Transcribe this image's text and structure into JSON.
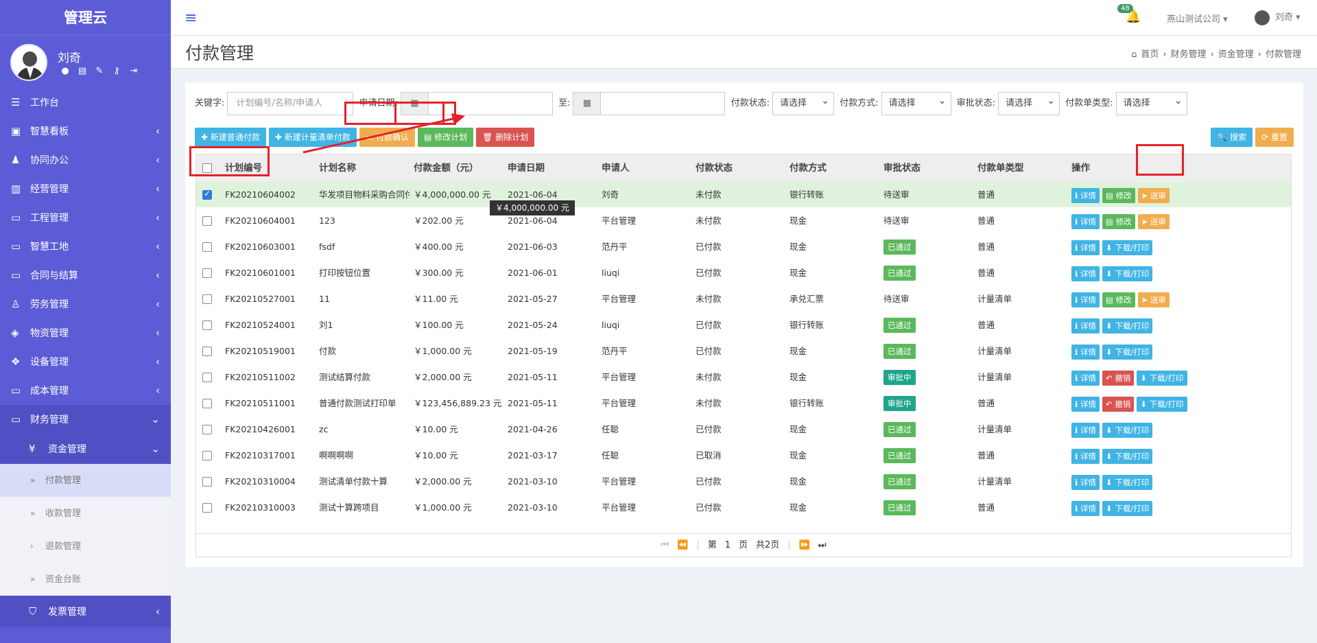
{
  "app": {
    "brand": "管理云"
  },
  "user": {
    "name": "刘奇",
    "icons": [
      "user-icon",
      "card-icon",
      "edit-icon",
      "key-icon",
      "logout-icon"
    ]
  },
  "header": {
    "notification_count": "48",
    "company": "燕山测试公司",
    "user": "刘奇"
  },
  "sidebar": {
    "items": [
      {
        "label": "工作台",
        "icon": "list-icon"
      },
      {
        "label": "智慧看板",
        "icon": "monitor-icon"
      },
      {
        "label": "协同办公",
        "icon": "users-icon"
      },
      {
        "label": "经营管理",
        "icon": "bar-chart-icon"
      },
      {
        "label": "工程管理",
        "icon": "desktop-icon"
      },
      {
        "label": "智慧工地",
        "icon": "desktop-icon"
      },
      {
        "label": "合同与结算",
        "icon": "desktop-icon"
      },
      {
        "label": "劳务管理",
        "icon": "worker-icon"
      },
      {
        "label": "物资管理",
        "icon": "cube-icon"
      },
      {
        "label": "设备管理",
        "icon": "cubes-icon"
      },
      {
        "label": "成本管理",
        "icon": "desktop-icon"
      },
      {
        "label": "财务管理",
        "icon": "desktop-icon"
      }
    ],
    "sub": {
      "label": "资金管理",
      "icon": "yen-icon"
    },
    "sub_items": [
      {
        "label": "付款管理",
        "active": true
      },
      {
        "label": "收款管理",
        "active": false
      },
      {
        "label": "退款管理",
        "active": false
      },
      {
        "label": "资金台账",
        "active": false
      }
    ],
    "last": {
      "label": "发票管理",
      "icon": "tags-icon"
    }
  },
  "page": {
    "title": "付款管理",
    "breadcrumb": [
      "首页",
      "财务管理",
      "资金管理",
      "付款管理"
    ]
  },
  "filters": {
    "keyword_label": "关键字:",
    "keyword_placeholder": "计划编号/名称/申请人",
    "date_label": "申请日期:",
    "to_label": "至:",
    "pay_status_label": "付款状态:",
    "pay_method_label": "付款方式:",
    "approve_status_label": "审批状态:",
    "order_type_label": "付款单类型:",
    "select_default": "请选择"
  },
  "toolbar": {
    "new_normal": "新建普通付款",
    "new_measure": "新建计量清单付款",
    "confirm": "付款确认",
    "modify": "修改计划",
    "delete": "删除计划",
    "search": "搜索",
    "reset": "重置"
  },
  "table": {
    "columns": [
      "计划编号",
      "计划名称",
      "付款金额（元）",
      "申请日期",
      "申请人",
      "付款状态",
      "付款方式",
      "审批状态",
      "付款单类型",
      "操作"
    ],
    "rows": [
      {
        "code": "FK20210604002",
        "name": "华发项目物料采购合同付",
        "amount": "￥4,000,000.00 元",
        "date": "2021-06-04",
        "applicant": "刘奇",
        "pay_status": "未付款",
        "method": "银行转账",
        "approve": "待送审",
        "type": "普通",
        "checked": true,
        "actions": [
          "详情",
          "修改",
          "送审"
        ]
      },
      {
        "code": "FK20210604001",
        "name": "123",
        "amount": "￥202.00 元",
        "date": "2021-06-04",
        "applicant": "平台管理",
        "pay_status": "未付款",
        "method": "现金",
        "approve": "待送审",
        "type": "普通",
        "checked": false,
        "actions": [
          "详情",
          "修改",
          "送审"
        ]
      },
      {
        "code": "FK20210603001",
        "name": "fsdf",
        "amount": "￥400.00 元",
        "date": "2021-06-03",
        "applicant": "范丹平",
        "pay_status": "已付款",
        "method": "现金",
        "approve": "已通过",
        "type": "普通",
        "checked": false,
        "actions": [
          "详情",
          "下载/打印"
        ]
      },
      {
        "code": "FK20210601001",
        "name": "打印按钮位置",
        "amount": "￥300.00 元",
        "date": "2021-06-01",
        "applicant": "liuqi",
        "pay_status": "已付款",
        "method": "现金",
        "approve": "已通过",
        "type": "普通",
        "checked": false,
        "actions": [
          "详情",
          "下载/打印"
        ]
      },
      {
        "code": "FK20210527001",
        "name": "11",
        "amount": "￥11.00 元",
        "date": "2021-05-27",
        "applicant": "平台管理",
        "pay_status": "未付款",
        "method": "承兑汇票",
        "approve": "待送审",
        "type": "计量清单",
        "checked": false,
        "actions": [
          "详情",
          "修改",
          "送审"
        ]
      },
      {
        "code": "FK20210524001",
        "name": "刘1",
        "amount": "￥100.00 元",
        "date": "2021-05-24",
        "applicant": "liuqi",
        "pay_status": "已付款",
        "method": "银行转账",
        "approve": "已通过",
        "type": "普通",
        "checked": false,
        "actions": [
          "详情",
          "下载/打印"
        ]
      },
      {
        "code": "FK20210519001",
        "name": "付款",
        "amount": "￥1,000.00 元",
        "date": "2021-05-19",
        "applicant": "范丹平",
        "pay_status": "已付款",
        "method": "现金",
        "approve": "已通过",
        "type": "计量清单",
        "checked": false,
        "actions": [
          "详情",
          "下载/打印"
        ]
      },
      {
        "code": "FK20210511002",
        "name": "测试结算付款",
        "amount": "￥2,000.00 元",
        "date": "2021-05-11",
        "applicant": "平台管理",
        "pay_status": "未付款",
        "method": "现金",
        "approve": "审批中",
        "type": "计量清单",
        "checked": false,
        "actions": [
          "详情",
          "撤销",
          "下载/打印"
        ]
      },
      {
        "code": "FK20210511001",
        "name": "普通付款测试打印单",
        "amount": "￥123,456,889.23 元",
        "date": "2021-05-11",
        "applicant": "平台管理",
        "pay_status": "未付款",
        "method": "银行转账",
        "approve": "审批中",
        "type": "普通",
        "checked": false,
        "actions": [
          "详情",
          "撤销",
          "下载/打印"
        ]
      },
      {
        "code": "FK20210426001",
        "name": "zc",
        "amount": "￥10.00 元",
        "date": "2021-04-26",
        "applicant": "任聪",
        "pay_status": "已付款",
        "method": "现金",
        "approve": "已通过",
        "type": "计量清单",
        "checked": false,
        "actions": [
          "详情",
          "下载/打印"
        ]
      },
      {
        "code": "FK20210317001",
        "name": "啊啊啊啊",
        "amount": "￥10.00 元",
        "date": "2021-03-17",
        "applicant": "任聪",
        "pay_status": "已取消",
        "method": "现金",
        "approve": "已通过",
        "type": "普通",
        "checked": false,
        "actions": [
          "详情",
          "下载/打印"
        ]
      },
      {
        "code": "FK20210310004",
        "name": "测试清单付款十算",
        "amount": "￥2,000.00 元",
        "date": "2021-03-10",
        "applicant": "平台管理",
        "pay_status": "已付款",
        "method": "现金",
        "approve": "已通过",
        "type": "计量清单",
        "checked": false,
        "actions": [
          "详情",
          "下载/打印"
        ]
      },
      {
        "code": "FK20210310003",
        "name": "测试十算跨项目",
        "amount": "￥1,000.00 元",
        "date": "2021-03-10",
        "applicant": "平台管理",
        "pay_status": "已付款",
        "method": "现金",
        "approve": "已通过",
        "type": "普通",
        "checked": false,
        "actions": [
          "详情",
          "下载/打印"
        ]
      }
    ]
  },
  "tooltip": "￥4,000,000.00 元",
  "pager": {
    "page_prefix": "第",
    "page_value": "1",
    "page_suffix": "页",
    "total": "共2页"
  },
  "colors": {
    "sidebar": "#5c5cd6",
    "primary": "#3fb4e5",
    "success": "#5cb85c",
    "warning": "#f0ad4e",
    "danger": "#d9534f",
    "annotation": "#e5202a"
  }
}
